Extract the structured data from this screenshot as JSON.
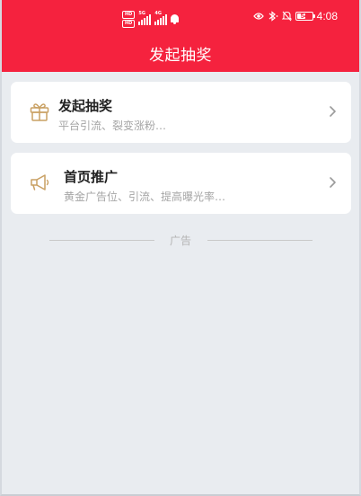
{
  "status_bar": {
    "time": "4:08",
    "battery_level": "54",
    "left_icons": [
      "hd-icon",
      "signal-5g-icon",
      "signal-4g-icon",
      "notification-bell-icon"
    ],
    "right_icons": [
      "eye-icon",
      "bluetooth-icon",
      "mute-icon",
      "battery-icon"
    ],
    "hd_labels": [
      "HD",
      "HD"
    ],
    "signal_tags": [
      "5G",
      "4G"
    ]
  },
  "header": {
    "title": "发起抽奖",
    "background_color": "#f5223e"
  },
  "cards": [
    {
      "title": "发起抽奖",
      "subtitle": "平台引流、裂变涨粉…",
      "icon": "gift-icon"
    },
    {
      "title": "首页推广",
      "subtitle": "黄金广告位、引流、提高曝光率…",
      "icon": "megaphone-icon"
    }
  ],
  "ad_divider": {
    "label": "广告"
  },
  "colors": {
    "accent": "#f5223e",
    "icon_gold": "#c9a063",
    "background": "#e9ecf0"
  }
}
